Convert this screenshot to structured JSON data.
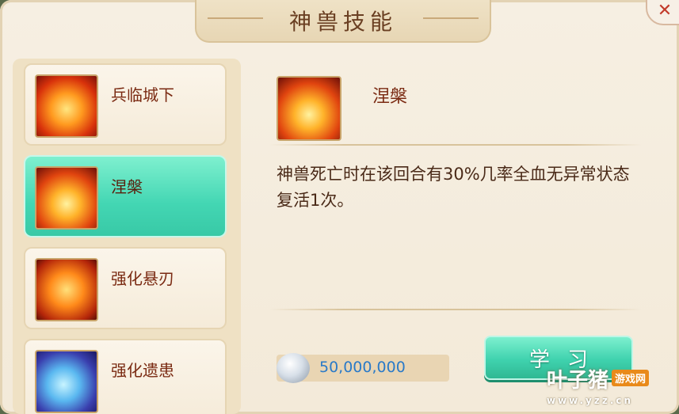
{
  "dialog": {
    "title": "神兽技能",
    "close_symbol": "✕"
  },
  "skill_list": [
    {
      "name": "兵临城下",
      "icon": "fire-demon-icon",
      "selected": false
    },
    {
      "name": "涅槃",
      "icon": "phoenix-icon",
      "selected": true
    },
    {
      "name": "强化悬刃",
      "icon": "swords-icon",
      "selected": false
    },
    {
      "name": "强化遗患",
      "icon": "swirl-icon",
      "selected": false
    }
  ],
  "detail": {
    "name": "涅槃",
    "icon": "phoenix-icon",
    "description": "神兽死亡时在该回合有30%几率全血无异常状态复活1次。"
  },
  "cost": {
    "currency_icon": "silver-ingot-icon",
    "value": "50,000,000"
  },
  "learn_button": {
    "label": "学习"
  },
  "watermark": {
    "brand": "叶子猪",
    "sub": "游戏网",
    "url": "www.yzz.cn"
  },
  "colors": {
    "selected_item": "#43d6b3",
    "learn_button": "#3fd2ae",
    "cost_text": "#2a7ac8",
    "label_text": "#7a2a12"
  }
}
